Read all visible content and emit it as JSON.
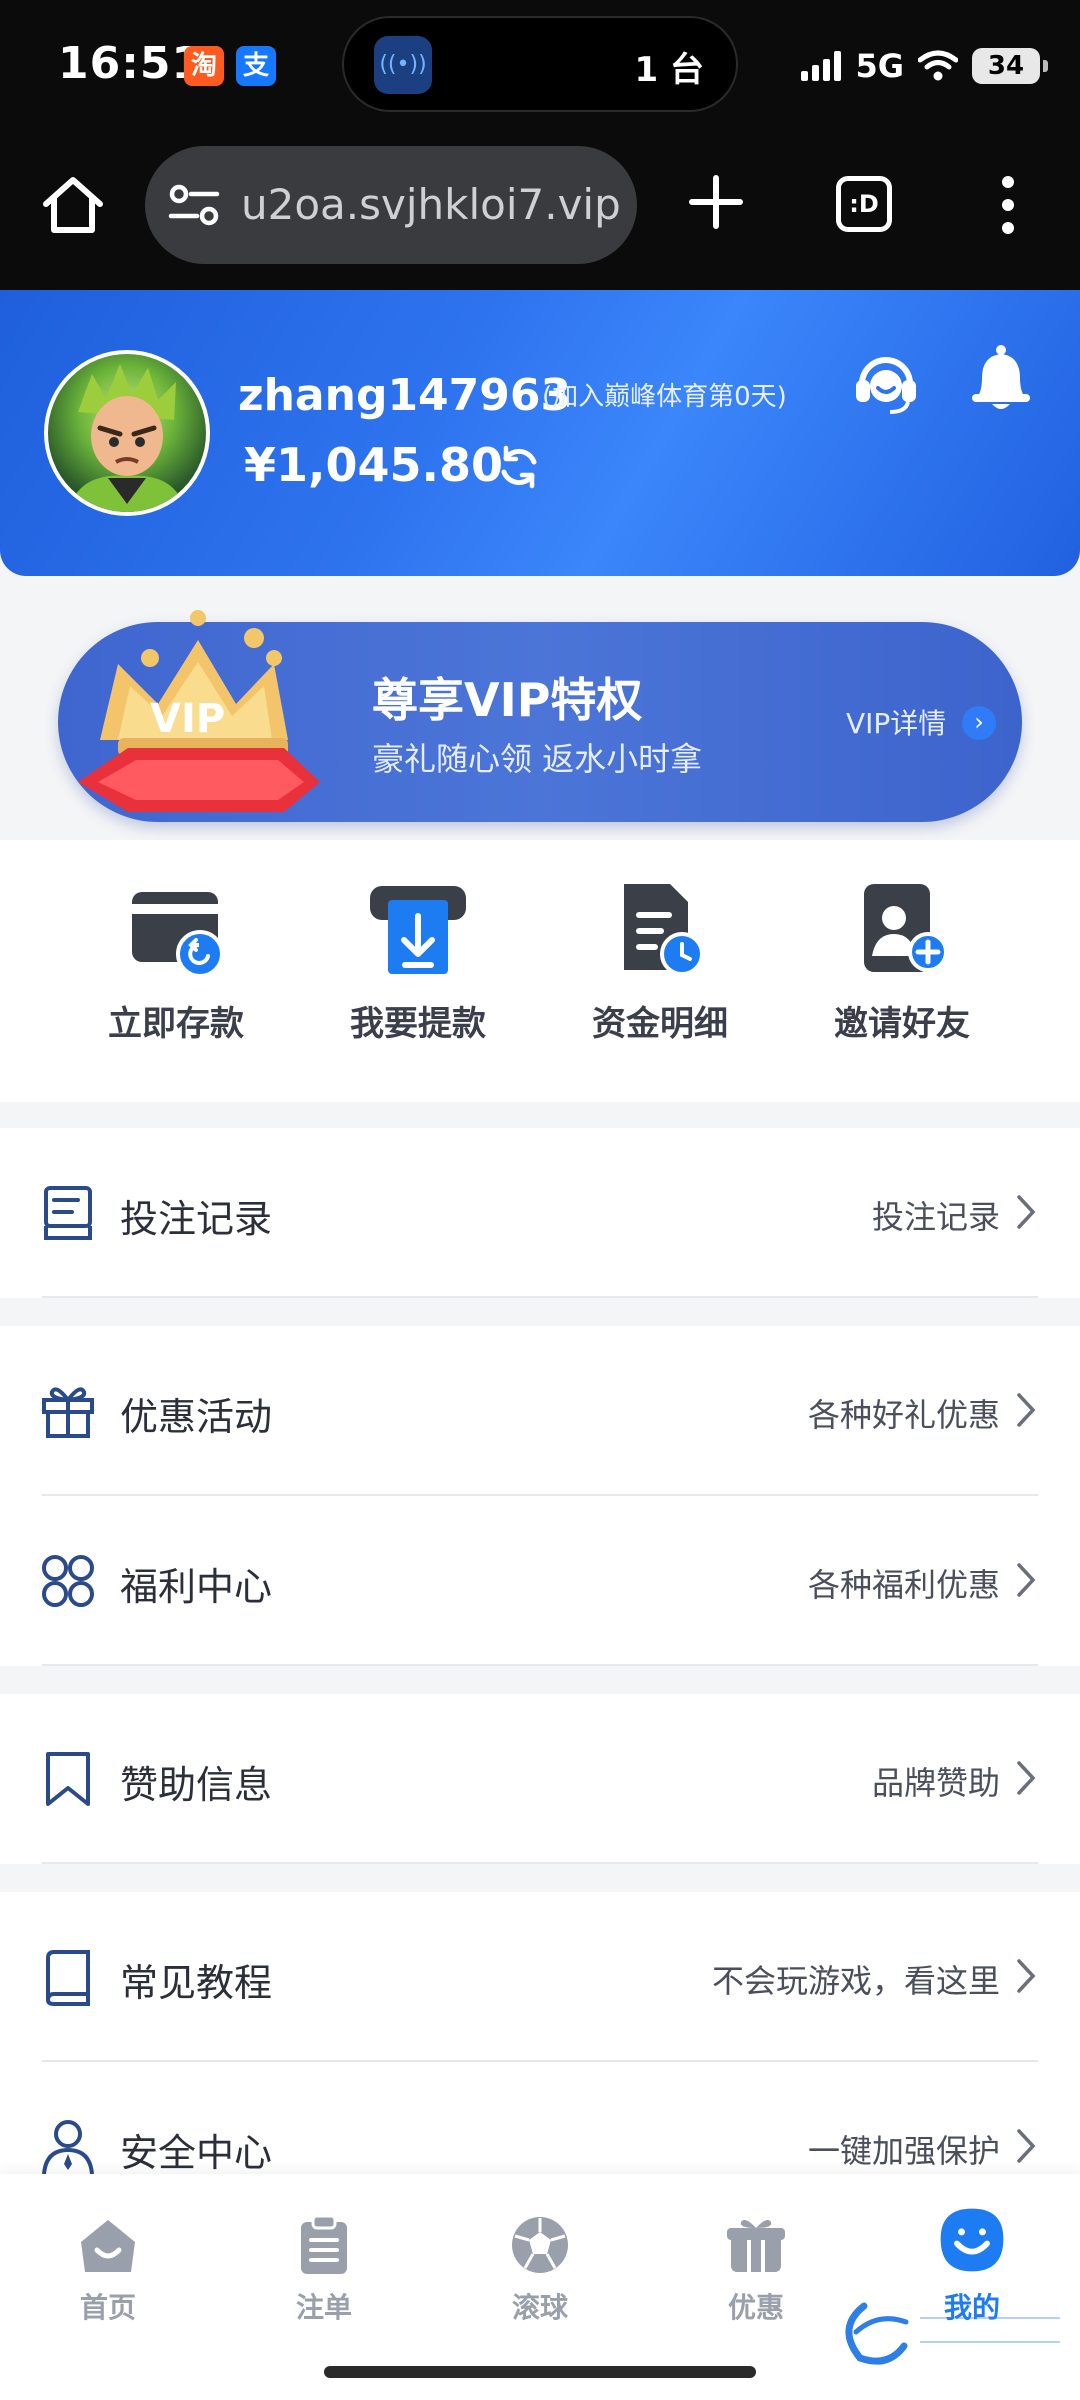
{
  "status_bar": {
    "time": "16:51",
    "app_badges": [
      "淘",
      "支"
    ],
    "island_app": "((•))",
    "island_text": "1 台",
    "network": "5G",
    "battery": "34"
  },
  "browser": {
    "url": "u2oa.svjhkloi7.vip",
    "tabs_label": ":D"
  },
  "profile": {
    "username": "zhang147963",
    "join_note": "(加入巅峰体育第0天)",
    "balance": "¥1,045.80"
  },
  "vip": {
    "title": "尊享VIP特权",
    "subtitle": "豪礼随心领 返水小时拿",
    "detail_link": "VIP详情"
  },
  "quick_actions": [
    {
      "label": "立即存款",
      "icon": "deposit-icon"
    },
    {
      "label": "我要提款",
      "icon": "withdraw-icon"
    },
    {
      "label": "资金明细",
      "icon": "fund-details-icon"
    },
    {
      "label": "邀请好友",
      "icon": "invite-friend-icon"
    }
  ],
  "menu": [
    {
      "label": "投注记录",
      "hint": "投注记录",
      "icon": "bet-record-icon"
    },
    {
      "label": "优惠活动",
      "hint": "各种好礼优惠",
      "icon": "gift-icon"
    },
    {
      "label": "福利中心",
      "hint": "各种福利优惠",
      "icon": "welfare-grid-icon"
    },
    {
      "label": "赞助信息",
      "hint": "品牌赞助",
      "icon": "bookmark-icon"
    },
    {
      "label": "常见教程",
      "hint": "不会玩游戏，看这里",
      "icon": "book-icon"
    },
    {
      "label": "安全中心",
      "hint": "一键加强保护",
      "icon": "security-user-icon"
    }
  ],
  "tabs": [
    {
      "label": "首页",
      "icon": "home-icon"
    },
    {
      "label": "注单",
      "icon": "orders-icon"
    },
    {
      "label": "滚球",
      "icon": "soccer-ball-icon"
    },
    {
      "label": "优惠",
      "icon": "promo-gift-icon"
    },
    {
      "label": "我的",
      "icon": "profile-face-icon",
      "active": true
    }
  ],
  "colors": {
    "accent": "#1e7cf2",
    "header_blue": "#2e73ee",
    "inactive_tab": "#9aa0ab"
  }
}
